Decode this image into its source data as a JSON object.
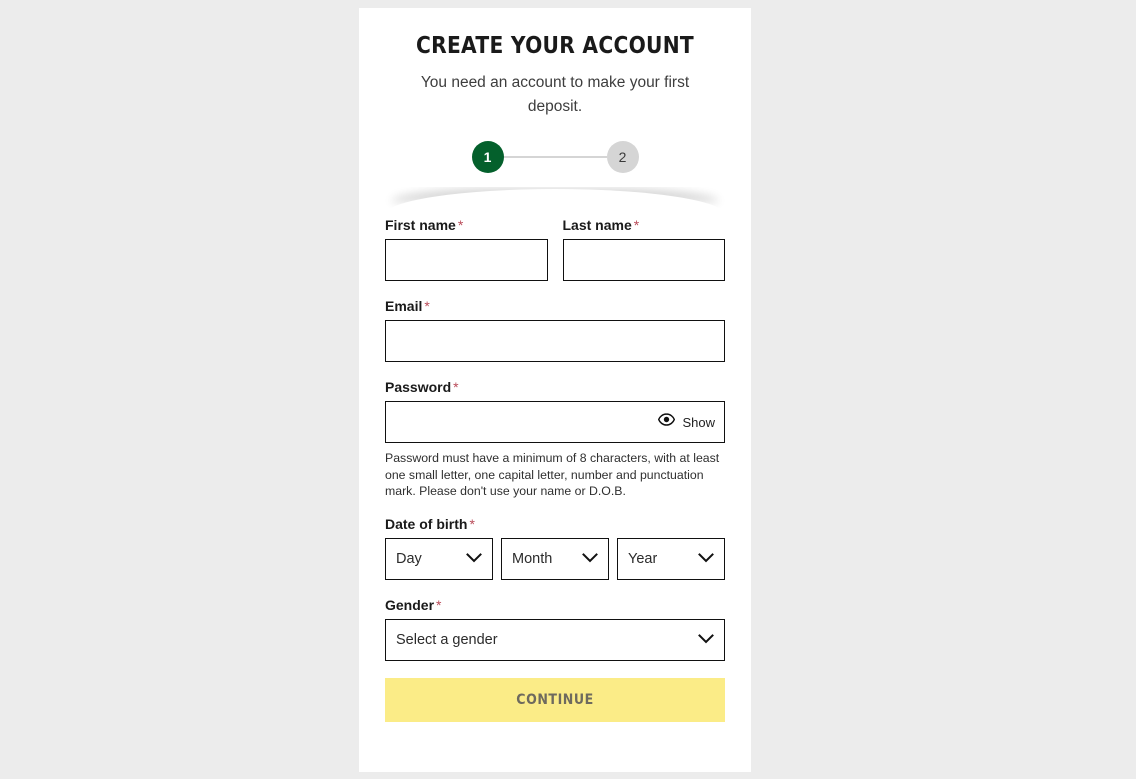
{
  "header": {
    "title": "CREATE YOUR ACCOUNT",
    "subtitle": "You need an account to make your first deposit."
  },
  "stepper": {
    "steps": [
      {
        "label": "1",
        "state": "active"
      },
      {
        "label": "2",
        "state": "inactive"
      }
    ],
    "active_color": "#04602c",
    "inactive_color": "#d5d5d5"
  },
  "form": {
    "first_name": {
      "label": "First name",
      "required_marker": "*",
      "value": "",
      "placeholder": ""
    },
    "last_name": {
      "label": "Last name",
      "required_marker": "*",
      "value": "",
      "placeholder": ""
    },
    "email": {
      "label": "Email",
      "required_marker": "*",
      "value": "",
      "placeholder": ""
    },
    "password": {
      "label": "Password",
      "required_marker": "*",
      "value": "",
      "placeholder": "",
      "show_label": "Show",
      "helper_text": "Password must have a minimum of 8 characters, with at least one small letter, one capital letter, number and punctuation mark. Please don't use your name or D.O.B."
    },
    "date_of_birth": {
      "label": "Date of birth",
      "required_marker": "*",
      "day": "Day",
      "month": "Month",
      "year": "Year"
    },
    "gender": {
      "label": "Gender",
      "required_marker": "*",
      "value": "Select a gender"
    }
  },
  "actions": {
    "continue_label": "CONTINUE",
    "continue_bg": "#fbec87",
    "continue_text_color": "#6e6a5e"
  },
  "theme": {
    "page_background": "#ececec",
    "card_background": "#ffffff",
    "required_color": "#b94a58",
    "border_color": "#111111"
  }
}
